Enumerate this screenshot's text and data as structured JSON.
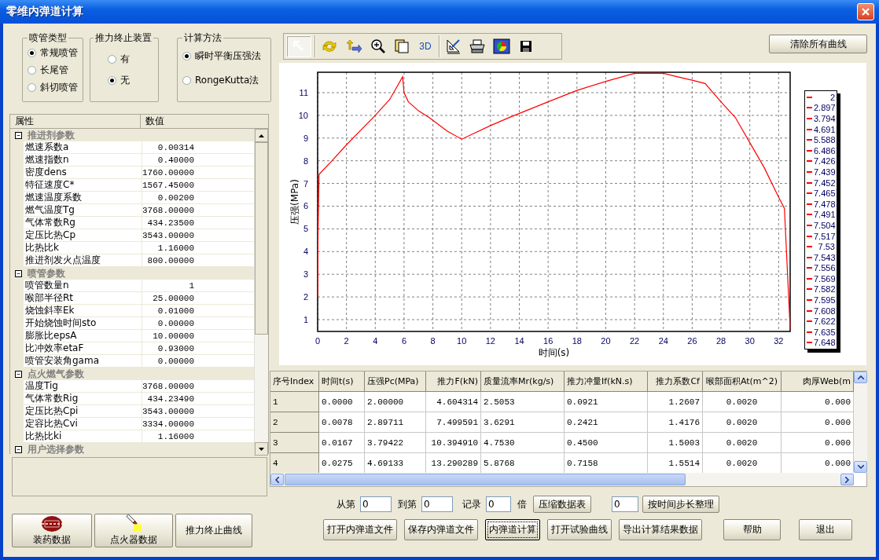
{
  "window": {
    "title": "零维内弹道计算"
  },
  "option_groups": [
    {
      "title": "喷管类型",
      "options": [
        {
          "label": "常规喷管",
          "selected": true
        },
        {
          "label": "长尾管",
          "selected": false
        },
        {
          "label": "斜切喷管",
          "selected": false
        }
      ]
    },
    {
      "title": "推力终止装置",
      "options": [
        {
          "label": "有",
          "selected": false
        },
        {
          "label": "无",
          "selected": true
        }
      ]
    },
    {
      "title": "计算方法",
      "options": [
        {
          "label": "瞬时平衡压强法",
          "selected": true
        },
        {
          "label": "RongeKutta法",
          "selected": false
        }
      ]
    }
  ],
  "property_grid": {
    "columns": [
      "属性",
      "数值"
    ],
    "groups": [
      {
        "label": "推进剂参数",
        "expanded": true,
        "rows": [
          {
            "name": "燃速系数a",
            "value": "0.00314"
          },
          {
            "name": "燃速指数n",
            "value": "0.40000"
          },
          {
            "name": "密度dens",
            "value": "1760.00000"
          },
          {
            "name": "特征速度C*",
            "value": "1567.45000"
          },
          {
            "name": "燃速温度系数",
            "value": "0.00200"
          },
          {
            "name": "燃气温度Tg",
            "value": "3768.00000"
          },
          {
            "name": "气体常数Rg",
            "value": "434.23500"
          },
          {
            "name": "定压比热Cp",
            "value": "3543.00000"
          },
          {
            "name": "比热比k",
            "value": "1.16000"
          },
          {
            "name": "推进剂发火点温度",
            "value": "800.00000"
          }
        ]
      },
      {
        "label": "喷管参数",
        "expanded": true,
        "rows": [
          {
            "name": "喷管数量n",
            "value": "1"
          },
          {
            "name": "喉部半径Rt",
            "value": "25.00000"
          },
          {
            "name": "烧蚀斜率Ek",
            "value": "0.01000"
          },
          {
            "name": "开始烧蚀时间sto",
            "value": "0.00000"
          },
          {
            "name": "膨胀比epsA",
            "value": "10.00000"
          },
          {
            "name": "比冲效率etaF",
            "value": "0.93000"
          },
          {
            "name": "喷管安装角gama",
            "value": "0.00000"
          }
        ]
      },
      {
        "label": "点火燃气参数",
        "expanded": true,
        "rows": [
          {
            "name": "温度Tig",
            "value": "3768.00000"
          },
          {
            "name": "气体常数Rig",
            "value": "434.23490"
          },
          {
            "name": "定压比热Cpi",
            "value": "3543.00000"
          },
          {
            "name": "定容比热Cvi",
            "value": "3334.00000"
          },
          {
            "name": "比热比ki",
            "value": "1.16000"
          }
        ]
      },
      {
        "label": "用户选择参数",
        "expanded": true
      }
    ]
  },
  "left_buttons": [
    {
      "label": "装药数据",
      "kind": "grain"
    },
    {
      "label": "点火器数据",
      "kind": "igniter"
    },
    {
      "label": "推力终止曲线",
      "kind": "text"
    }
  ],
  "toolbar": [
    {
      "kind": "pointer",
      "selected": true
    },
    {
      "kind": "rotate",
      "selected": false
    },
    {
      "kind": "pan",
      "selected": false
    },
    {
      "kind": "zoom",
      "selected": false
    },
    {
      "kind": "copy",
      "selected": false
    },
    {
      "kind": "label",
      "label": "3D",
      "selected": false
    },
    {
      "kind": "measure",
      "selected": false
    },
    {
      "kind": "print",
      "selected": false
    },
    {
      "kind": "chart",
      "selected": false
    },
    {
      "kind": "save",
      "selected": false
    }
  ],
  "clear_button": "清除所有曲线",
  "chart": {
    "chart_data": {
      "type": "line",
      "grid": true,
      "xlabel": "时间(s)",
      "ylabel": "压强(MPa)",
      "xlim": [
        0,
        32.8
      ],
      "ylim": [
        0.48,
        11.9
      ],
      "xticks": [
        0,
        2,
        4,
        6,
        8,
        10,
        12,
        14,
        16,
        18,
        20,
        22,
        24,
        26,
        28,
        30,
        32
      ],
      "yticks": [
        1,
        2,
        3,
        4,
        5,
        6,
        7,
        8,
        9,
        10,
        11
      ],
      "x": [
        0,
        0.03,
        0.1,
        1,
        2,
        3,
        4,
        5,
        5.9,
        6,
        6.3,
        7,
        7.75,
        9,
        10,
        12,
        13.4,
        16,
        18,
        20,
        22,
        24,
        25,
        26,
        26.9,
        28,
        29,
        30,
        31,
        32,
        32.4,
        32.8
      ],
      "series": [
        {
          "color": "#ff0000",
          "values": [
            2,
            4.69,
            7.4,
            8.0,
            8.7,
            9.35,
            10.0,
            10.7,
            11.7,
            11.0,
            10.6,
            10.2,
            9.9,
            9.3,
            8.95,
            9.55,
            9.93,
            10.6,
            11.1,
            11.5,
            11.85,
            11.85,
            11.7,
            11.55,
            11.4,
            10.6,
            9.9,
            8.8,
            7.7,
            6.4,
            5.9,
            0.6
          ]
        }
      ]
    },
    "legend": [
      "2",
      "2.897",
      "3.794",
      "4.691",
      "5.588",
      "6.486",
      "7.426",
      "7.439",
      "7.452",
      "7.465",
      "7.478",
      "7.491",
      "7.504",
      "7.517",
      "7.53",
      "7.543",
      "7.556",
      "7.569",
      "7.582",
      "7.595",
      "7.608",
      "7.622",
      "7.635",
      "7.648"
    ]
  },
  "table": {
    "columns": [
      "序号Index",
      "时间t(s)",
      "压强Pc(MPa)",
      "推力F(kN)",
      "质量流率Mr(kg/s)",
      "推力冲量If(kN.s)",
      "推力系数Cf",
      "喉部面积At(m^2)",
      "肉厚Web(m"
    ],
    "rows": [
      [
        "1",
        "0.0000",
        "2.00000",
        "4.604314",
        "2.5053",
        "0.0921",
        "1.2607",
        "0.0020",
        "0.000"
      ],
      [
        "2",
        "0.0078",
        "2.89711",
        "7.499591",
        "3.6291",
        "0.2421",
        "1.4176",
        "0.0020",
        "0.000"
      ],
      [
        "3",
        "0.0167",
        "3.79422",
        "10.394910",
        "4.7530",
        "0.4500",
        "1.5003",
        "0.0020",
        "0.000"
      ],
      [
        "4",
        "0.0275",
        "4.69133",
        "13.290289",
        "5.8768",
        "0.7158",
        "1.5514",
        "0.0020",
        "0.000"
      ]
    ]
  },
  "compress": {
    "from_label": "从第",
    "from_value": "0",
    "to_label": "到第",
    "to_value": "0",
    "record_label": "记录",
    "factor_value": "0",
    "factor_label": "倍",
    "compress_button": "压缩数据表",
    "step_value": "0",
    "step_button": "按时间步长整理"
  },
  "buttons": [
    {
      "label": "打开内弹道文件",
      "focused": false
    },
    {
      "label": "保存内弹道文件",
      "focused": false
    },
    {
      "label": "内弹道计算",
      "focused": true
    },
    {
      "label": "打开试验曲线",
      "focused": false
    },
    {
      "label": "导出计算结果数据",
      "focused": false
    },
    {
      "label": "帮助",
      "focused": false
    },
    {
      "label": "退出",
      "focused": false
    }
  ]
}
